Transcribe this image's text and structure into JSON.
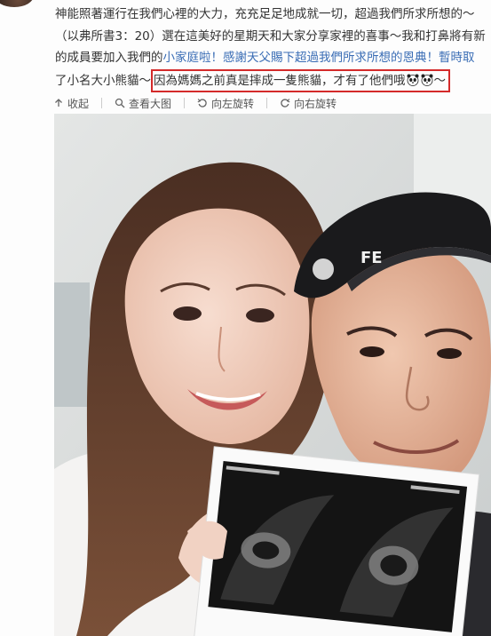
{
  "post": {
    "lines": [
      "神能照著運行在我們心裡的大力，充充足足地成就一切，超過我們所求所想的～",
      "（以弗所書3：20）選在這美好的星期天和大家分享家裡的喜事～我和打鼻將有新",
      "的成員要加入我們的",
      "小家庭啦！感謝天父賜下超過我們所求所想的恩典！暫時取"
    ],
    "line4_prefix": "了小名大小熊貓～",
    "highlighted_text": "因為媽媽之前真是摔成一隻熊貓，才有了他們哦",
    "highlight_suffix": "～",
    "highlight_color": "#d42a2a",
    "link_color": "#3a6db5"
  },
  "toolbar": {
    "collapse": {
      "label": "收起",
      "icon": "arrow-up-icon"
    },
    "view_large": {
      "label": "查看大图",
      "icon": "magnifier-icon"
    },
    "rotate_left": {
      "label": "向左旋转",
      "icon": "rotate-left-icon"
    },
    "rotate_right": {
      "label": "向右旋转",
      "icon": "rotate-right-icon"
    }
  },
  "photo": {
    "cap_text": "FE",
    "ultrasound_caption": "ultrasound print"
  }
}
